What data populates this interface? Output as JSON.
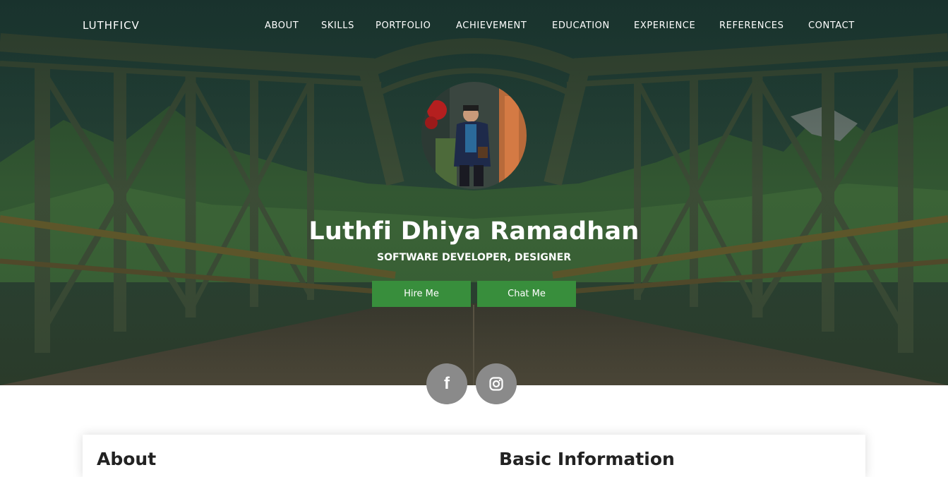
{
  "nav": {
    "brand": "LUTHFICV",
    "items": [
      "ABOUT",
      "SKILLS",
      "PORTFOLIO",
      "ACHIEVEMENT",
      "EDUCATION",
      "EXPERIENCE",
      "REFERENCES",
      "CONTACT"
    ]
  },
  "hero": {
    "name": "Luthfi Dhiya Ramadhan",
    "role": "SOFTWARE DEVELOPER, DESIGNER",
    "buttons": {
      "hire": "Hire Me",
      "chat": "Chat Me"
    },
    "social": [
      {
        "label": "f",
        "icon": "facebook-icon"
      },
      {
        "label": "",
        "icon": "instagram-icon"
      }
    ]
  },
  "sections": {
    "about_title": "About",
    "basic_title": "Basic Information"
  },
  "colors": {
    "button": "#388e3c",
    "social": "#8a8a8a",
    "overlay": "#1e3a2e"
  }
}
